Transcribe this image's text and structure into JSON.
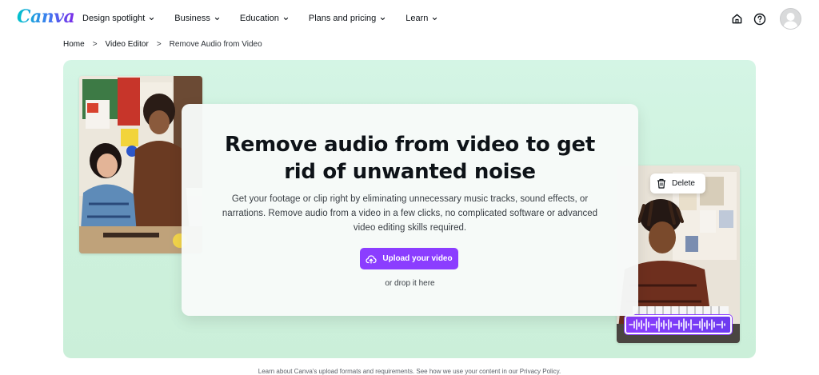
{
  "header": {
    "logo": "Canva",
    "nav": [
      {
        "label": "Design spotlight"
      },
      {
        "label": "Business"
      },
      {
        "label": "Education"
      },
      {
        "label": "Plans and pricing"
      },
      {
        "label": "Learn"
      }
    ],
    "icons": [
      "home-icon",
      "help-icon",
      "avatar"
    ]
  },
  "breadcrumb": {
    "items": [
      "Home",
      "Video Editor",
      "Remove Audio from Video"
    ],
    "separator": ">"
  },
  "hero": {
    "title": "Remove audio from video to get rid of unwanted noise",
    "description": "Get your footage or clip right by eliminating unnecessary music tracks, sound effects, or narrations. Remove audio from a video in a few clicks, no complicated software or advanced video editing skills required.",
    "upload_label": "Upload your video",
    "drop_text": "or drop it here",
    "delete_label": "Delete"
  },
  "footer_note": "Learn about Canva's upload formats and requirements. See how we use your content in our Privacy Policy.",
  "colors": {
    "accent": "#8b3dff",
    "hero_bg": "#d4f5e5",
    "logo_gradient": [
      "#00c4cc",
      "#3e7bf0",
      "#7d2ae8"
    ]
  }
}
